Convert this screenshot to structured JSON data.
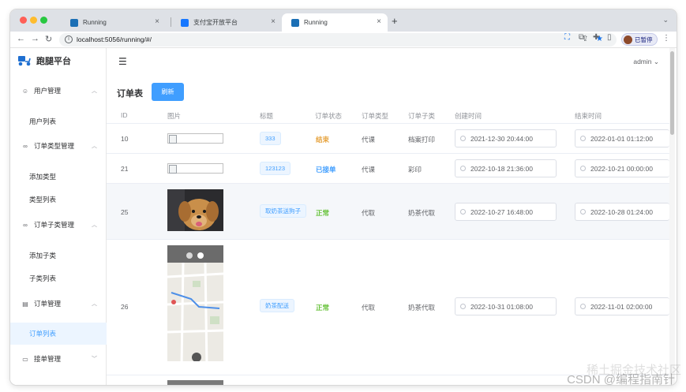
{
  "browser": {
    "tabs": [
      {
        "title": "Running"
      },
      {
        "title": "支付宝开放平台"
      },
      {
        "title": "Running"
      }
    ],
    "new_tab": "+",
    "url": "localhost:5056/running/#/",
    "profile_label": "已暂停"
  },
  "app": {
    "logo_text": "跑腿平台",
    "user": "admin"
  },
  "sidebar": {
    "groups": [
      {
        "label": "用户管理",
        "items": [
          "用户列表"
        ]
      },
      {
        "label": "订单类型管理",
        "items": [
          "添加类型",
          "类型列表"
        ]
      },
      {
        "label": "订单子类管理",
        "items": [
          "添加子类",
          "子类列表"
        ]
      },
      {
        "label": "订单管理",
        "items": [
          "订单列表"
        ]
      },
      {
        "label": "接单管理",
        "items": []
      }
    ],
    "active_item": "订单列表"
  },
  "page": {
    "title": "订单表",
    "refresh_label": "刷新"
  },
  "table": {
    "headers": [
      "ID",
      "图片",
      "标题",
      "订单状态",
      "订单类型",
      "订单子类",
      "创建时间",
      "结束时间"
    ],
    "rows": [
      {
        "id": "10",
        "title": "333",
        "status": "结束",
        "status_color": "#e6a23c",
        "type": "代课",
        "subtype": "档案打印",
        "created": "2021-12-30 20:44:00",
        "ended": "2022-01-01 01:12:00"
      },
      {
        "id": "21",
        "title": "123123",
        "status": "已接单",
        "status_color": "#409eff",
        "type": "代课",
        "subtype": "彩印",
        "created": "2022-10-18 21:36:00",
        "ended": "2022-10-21 00:00:00"
      },
      {
        "id": "25",
        "title": "取奶茶送狗子",
        "status": "正常",
        "status_color": "#67c23a",
        "type": "代取",
        "subtype": "奶茶代取",
        "created": "2022-10-27 16:48:00",
        "ended": "2022-10-28 01:24:00"
      },
      {
        "id": "26",
        "title": "奶茶配送",
        "status": "正常",
        "status_color": "#67c23a",
        "type": "代取",
        "subtype": "奶茶代取",
        "created": "2022-10-31 01:08:00",
        "ended": "2022-11-01 02:00:00"
      }
    ]
  },
  "watermark": "稀土掘金技术社区",
  "watermark2": "CSDN @编程指南针"
}
